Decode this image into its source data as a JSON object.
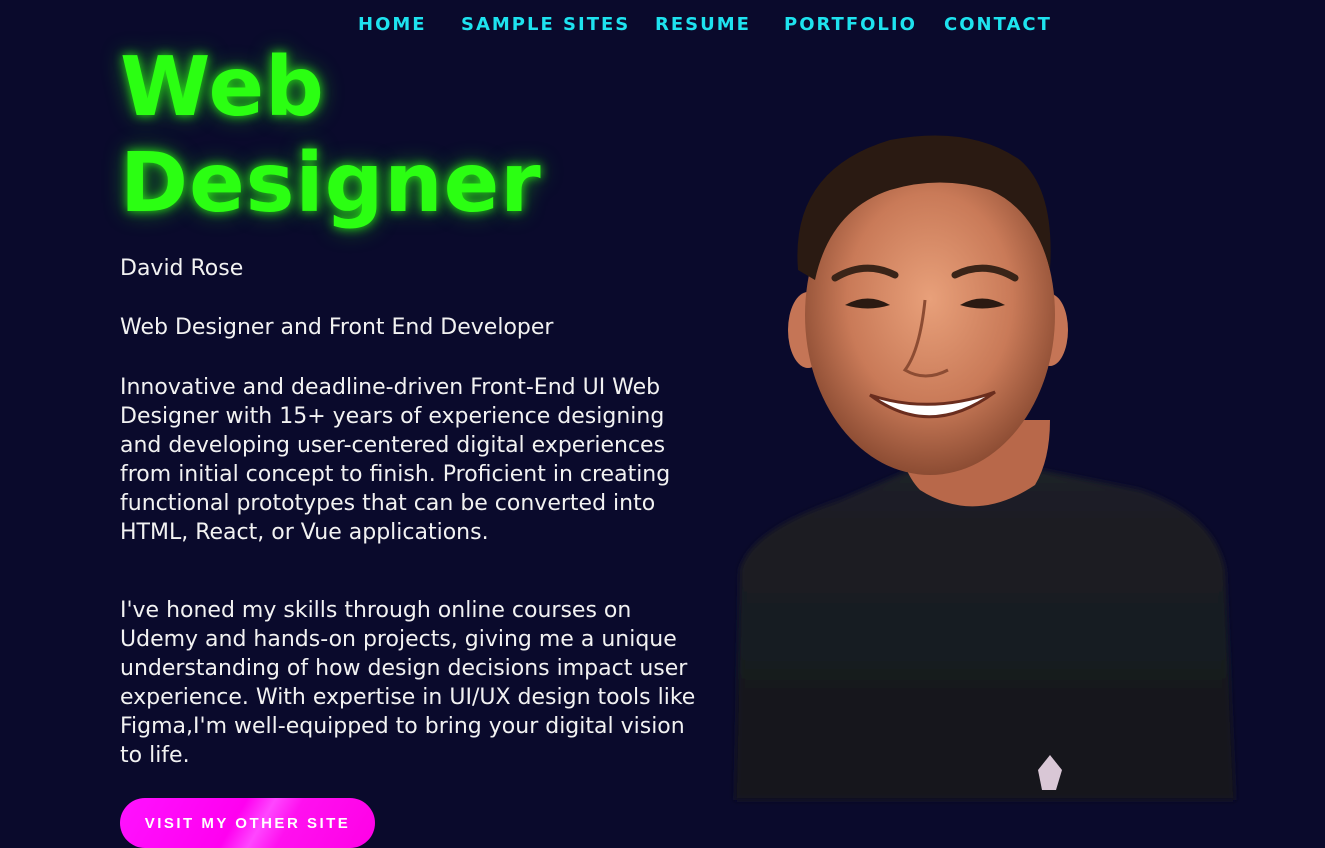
{
  "nav": {
    "items": [
      {
        "label": "HOME"
      },
      {
        "label": "SAMPLE SITES"
      },
      {
        "label": "RESUME"
      },
      {
        "label": "PORTFOLIO"
      },
      {
        "label": "CONTACT"
      }
    ]
  },
  "hero": {
    "title_line1": "Web",
    "title_line2": "Designer",
    "name": "David Rose",
    "role": "Web Designer and Front End Developer",
    "paragraph1": "Innovative and deadline-driven Front-End UI Web Designer with 15+ years of experience designing and developing user-centered digital experiences from initial concept to finish. Proficient in creating functional prototypes that can be converted into HTML, React, or Vue applications.",
    "paragraph2": "I've honed my skills through online courses on Udemy and hands-on projects, giving me a unique understanding of how design decisions impact user experience. With expertise in UI/UX design tools like Figma,I'm well-equipped to bring your digital vision to life.",
    "cta_label": "VISIT MY OTHER SITE"
  },
  "colors": {
    "background": "#0a0a2c",
    "nav": "#1ee3ef",
    "title": "#2bff12",
    "button": "#ff00f0"
  }
}
